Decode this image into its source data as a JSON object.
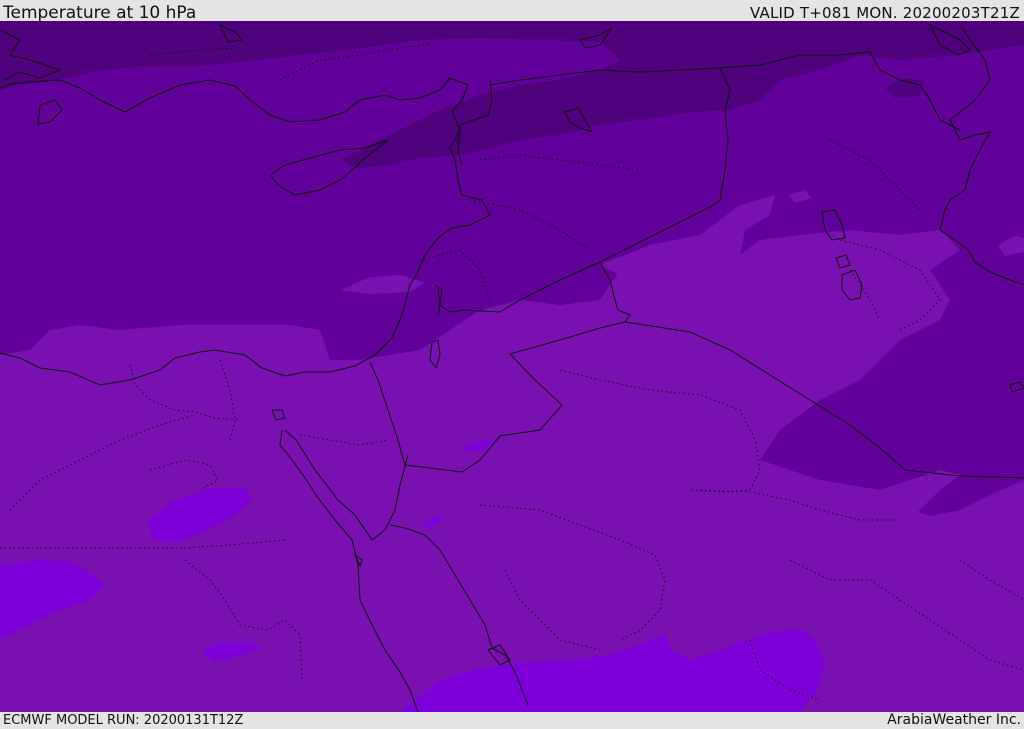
{
  "header": {
    "title": "Temperature at 10 hPa",
    "valid": "VALID T+081 MON. 20200203T21Z"
  },
  "footer": {
    "model_run": "ECMWF MODEL RUN: 20200131T12Z",
    "provider": "ArabiaWeather Inc."
  },
  "map": {
    "field": "temperature",
    "level": "10 hPa",
    "colors": {
      "darkest": "#4f007c",
      "dark": "#62009a",
      "mid": "#7911b1",
      "light": "#7d00d9",
      "coast": "#0d0d0d"
    }
  }
}
